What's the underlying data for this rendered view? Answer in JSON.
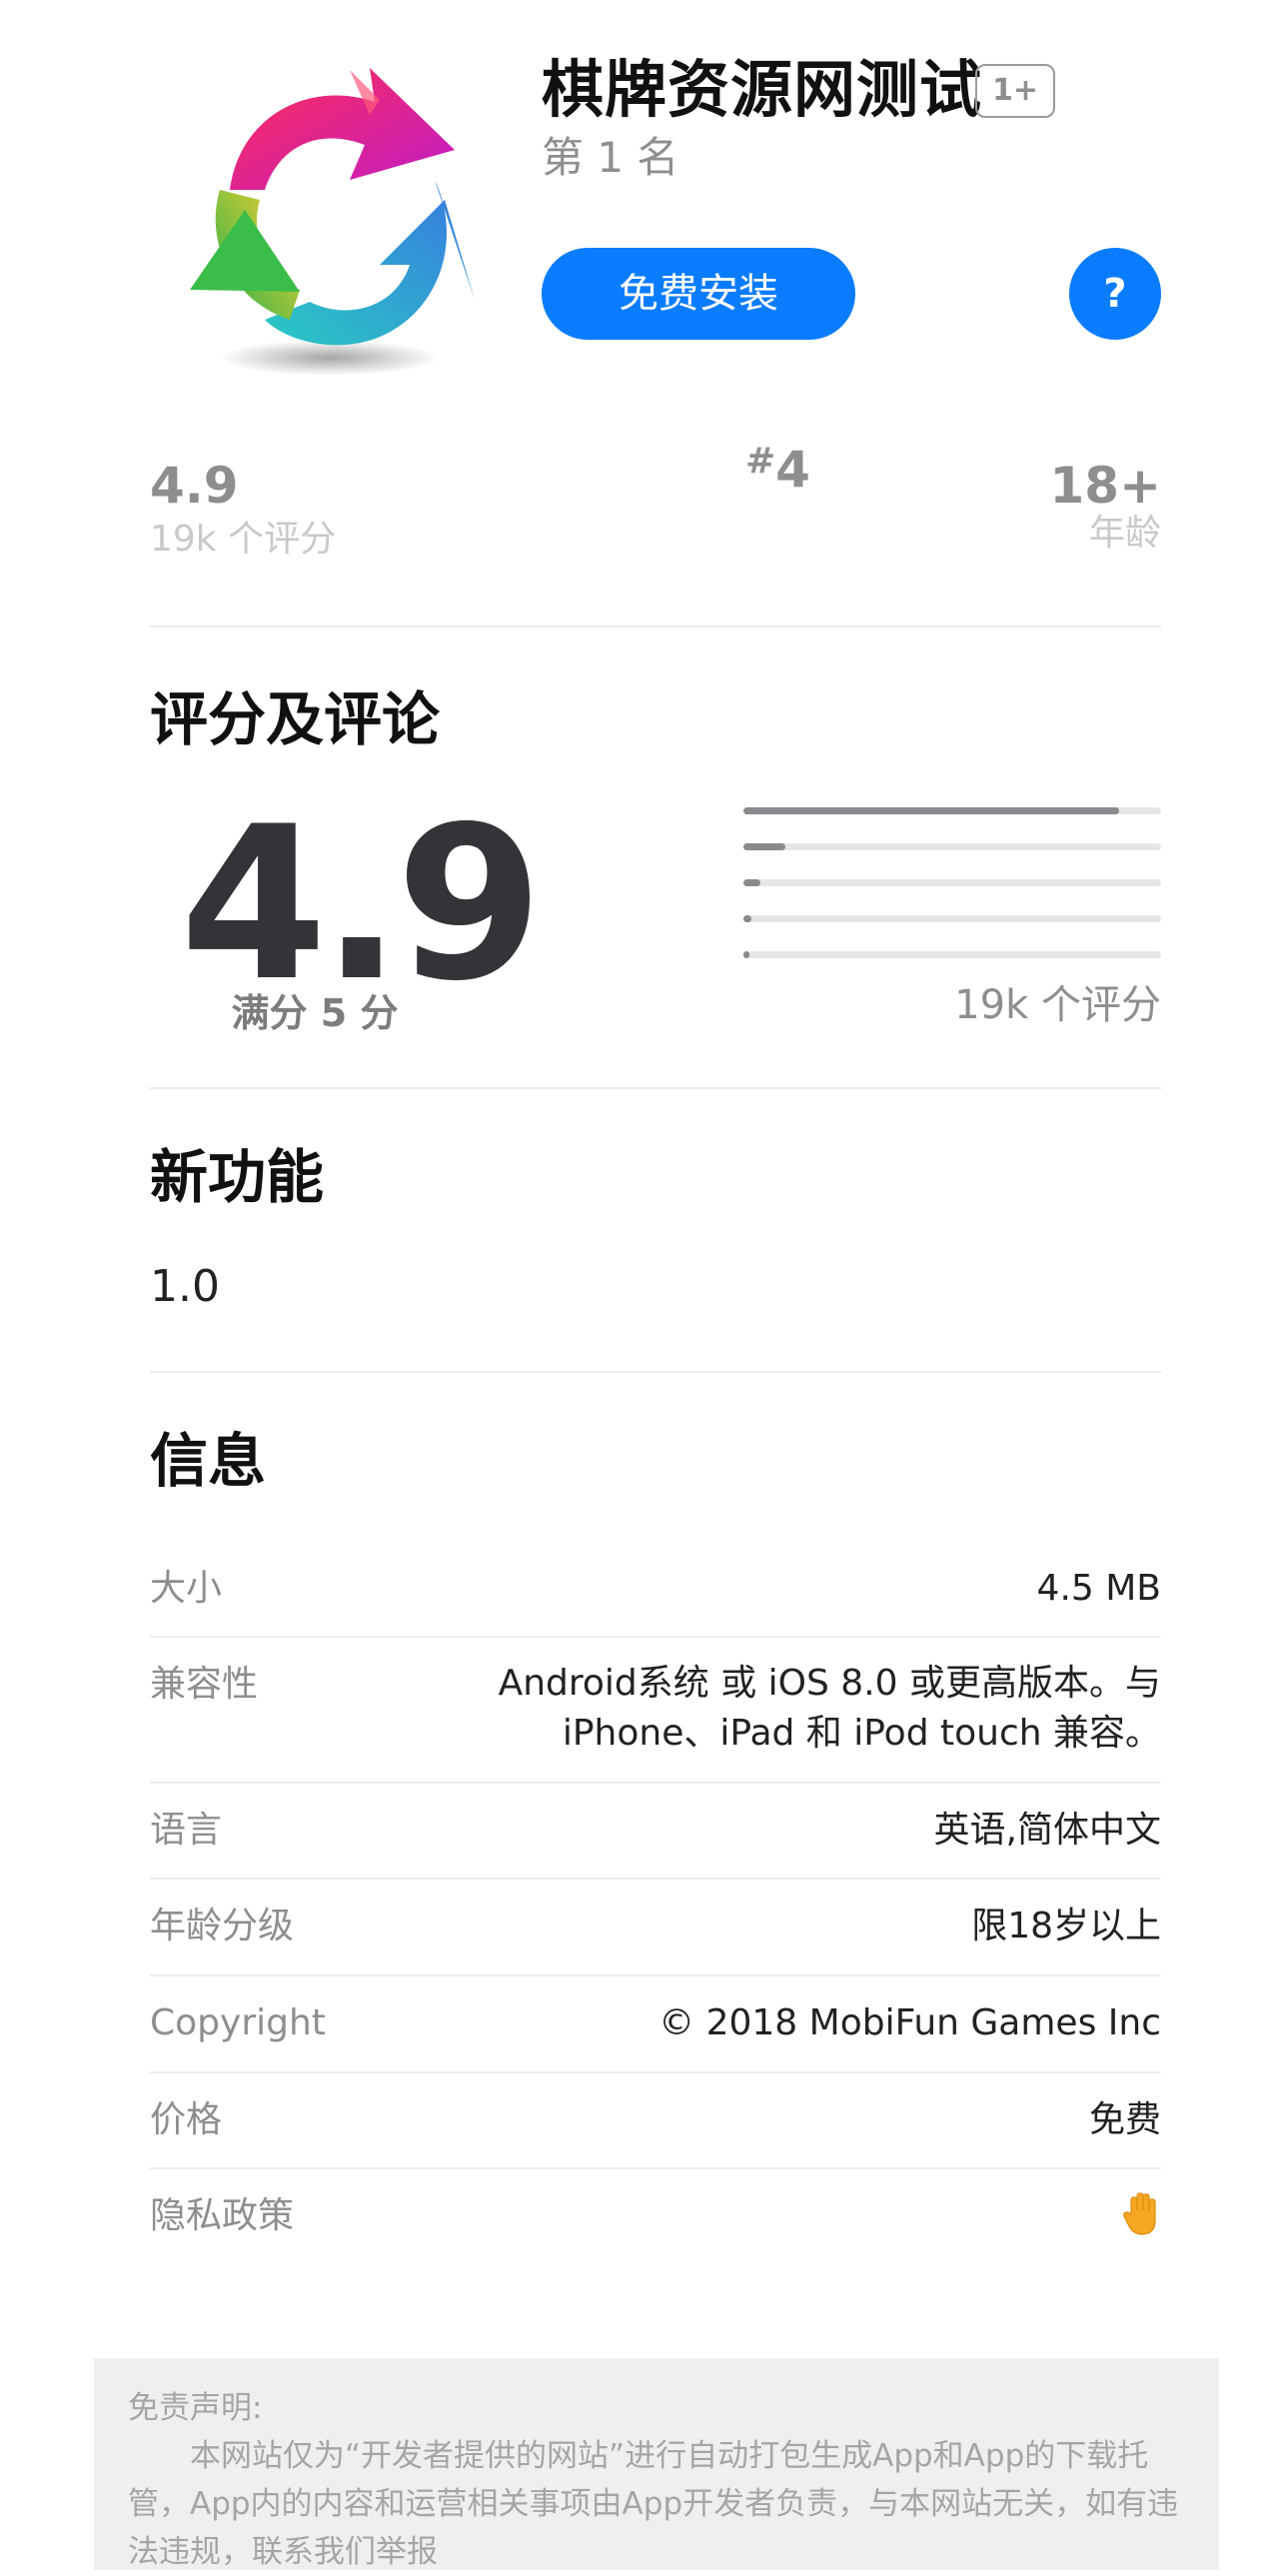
{
  "app": {
    "name": "棋牌资源网测试",
    "age_badge": "1+",
    "rank_text": "第 1 名",
    "install_label": "免费安装",
    "help_label": "?"
  },
  "stats": {
    "rating": "4.9",
    "rating_count_label": "19k 个评分",
    "rank_hash": "#",
    "rank_number": "4",
    "age": "18+",
    "age_label": "年龄"
  },
  "ratings": {
    "section_title": "评分及评论",
    "score": "4.9",
    "out_of": "满分 5 分",
    "count_label": "19k 个评分",
    "distribution": [
      0.9,
      0.1,
      0.04,
      0.02,
      0.01
    ]
  },
  "whats_new": {
    "section_title": "新功能",
    "version": "1.0"
  },
  "info": {
    "section_title": "信息",
    "rows": [
      {
        "label": "大小",
        "value": "4.5 MB"
      },
      {
        "label": "兼容性",
        "value_line1": "Android系统 或 iOS 8.0 或更高版本。与",
        "value_line2": "iPhone、iPad 和 iPod touch 兼容。"
      },
      {
        "label": "语言",
        "value": "英语,简体中文"
      },
      {
        "label": "年龄分级",
        "value": "限18岁以上"
      },
      {
        "label": "Copyright",
        "value": "© 2018 MobiFun Games Inc"
      },
      {
        "label": "价格",
        "value": "免费"
      },
      {
        "label": "隐私政策",
        "icon": "raised-hand-icon"
      }
    ]
  },
  "disclaimer": {
    "title": "免责声明:",
    "body": "本网站仅为“开发者提供的网站”进行自动打包生成App和App的下载托管，App内的内容和运营相关事项由App开发者负责，与本网站无关，如有违法违规，联系我们举报"
  },
  "colors": {
    "accent": "#0a7cff",
    "muted": "#8e8e8e",
    "bar_fill": "#8a8a8e",
    "disclaimer_bg": "#efefef"
  }
}
